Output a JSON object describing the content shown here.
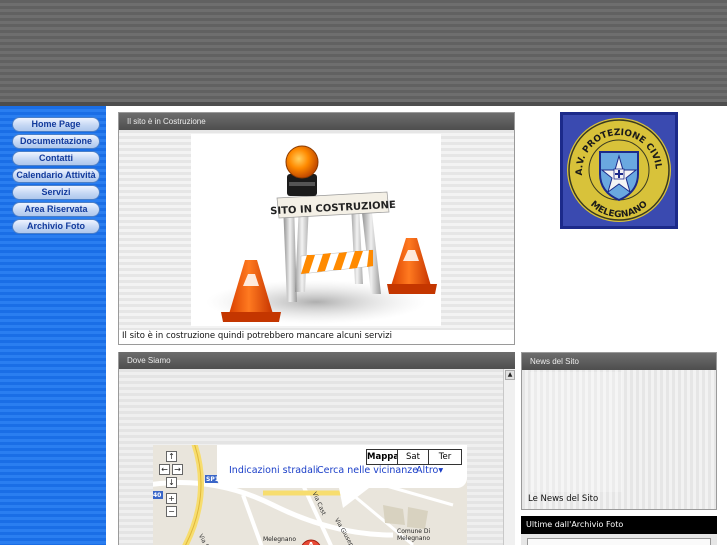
{
  "sidebar": {
    "items": [
      {
        "label": "Home Page"
      },
      {
        "label": "Documentazione"
      },
      {
        "label": "Contatti"
      },
      {
        "label": "Calendario Attività"
      },
      {
        "label": "Servizi"
      },
      {
        "label": "Area Riservata"
      },
      {
        "label": "Archivio Foto"
      }
    ]
  },
  "construction": {
    "header": "Il sito è in Costruzione",
    "sign_text": "SITO IN COSTRUZIONE",
    "caption": "Il sito è in costruzione quindi potrebbero mancare alcuni servizi"
  },
  "logo": {
    "text_top": "A.V. PROTEZIONE CIVILE",
    "text_bottom": "MELEGNANO"
  },
  "map": {
    "header": "Dove Siamo",
    "zoom": {
      "in": "+",
      "out": "−",
      "up": "↑",
      "down": "↓",
      "left": "←",
      "right": "→"
    },
    "links": {
      "directions": "Indicazioni stradali",
      "nearby": "Cerca nelle vicinanze",
      "more": "Altro▾"
    },
    "types": {
      "map": "Mappa",
      "sat": "Sat",
      "ter": "Ter"
    },
    "labels": {
      "road": "SP17",
      "route": "40",
      "town1": "Melegnano",
      "town2": "Comune Di",
      "town3": "Melegnano",
      "marker": "A",
      "street1": "Via Sav",
      "street2": "Via Cast",
      "street3": "Via Giusep"
    }
  },
  "news": {
    "header": "News del Sito",
    "link": "Le News del Sito"
  },
  "archive": {
    "header": "Ultime dall'Archivio Foto"
  },
  "colors": {
    "header_bg": "#616161",
    "sidebar_bg": "#1a6ee6",
    "nav_text": "#123a9c",
    "link": "#1a3ec8"
  }
}
